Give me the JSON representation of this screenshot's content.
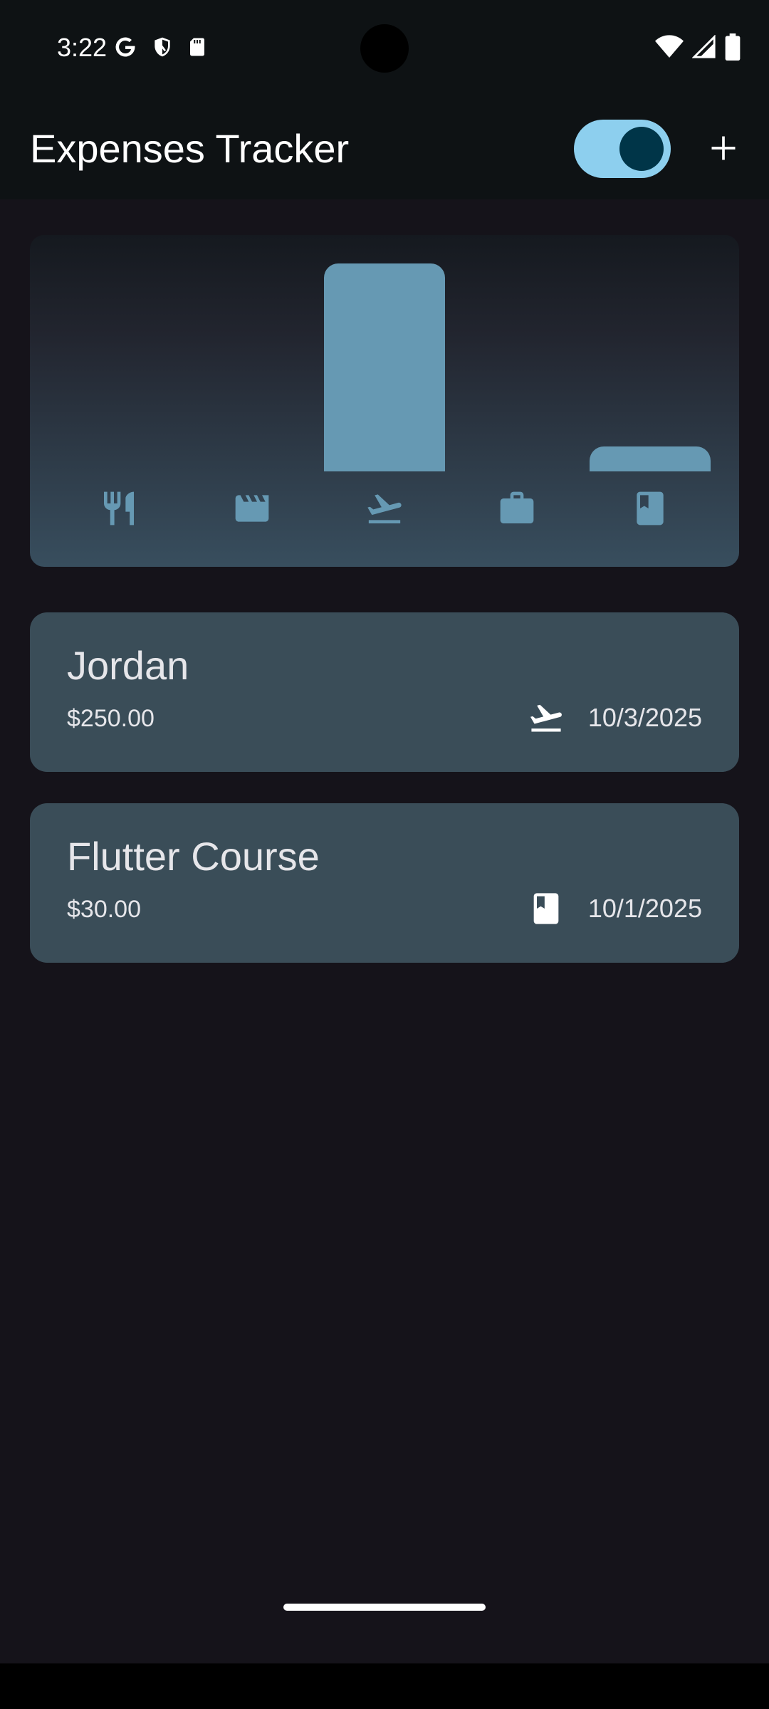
{
  "status_bar": {
    "time": "3:22",
    "left_icons": [
      "google-icon",
      "shield-icon",
      "sd-card-icon"
    ],
    "right_icons": [
      "wifi-icon",
      "signal-icon",
      "battery-icon"
    ]
  },
  "app_bar": {
    "title": "Expenses Tracker",
    "dark_mode_switch_on": true,
    "add_icon": "add-icon"
  },
  "chart_data": {
    "type": "bar",
    "categories": [
      "food",
      "leisure",
      "travel",
      "work",
      "education"
    ],
    "values": [
      0,
      0,
      250,
      0,
      30
    ],
    "ylim": [
      0,
      250
    ],
    "icons": [
      "restaurant-icon",
      "movie-icon",
      "flight-takeoff-icon",
      "work-icon",
      "book-icon"
    ],
    "bar_color": "#6699b3"
  },
  "expenses": [
    {
      "title": "Jordan",
      "amount": "$250.00",
      "category_icon": "flight-takeoff-icon",
      "date": "10/3/2025"
    },
    {
      "title": "Flutter Course",
      "amount": "$30.00",
      "category_icon": "book-icon",
      "date": "10/1/2025"
    }
  ],
  "colors": {
    "background": "#15131a",
    "app_bar": "#0e1214",
    "card": "#3a4d58",
    "switch_track": "#8dcfee",
    "switch_thumb": "#003548",
    "chart_icon": "#6699b3"
  }
}
